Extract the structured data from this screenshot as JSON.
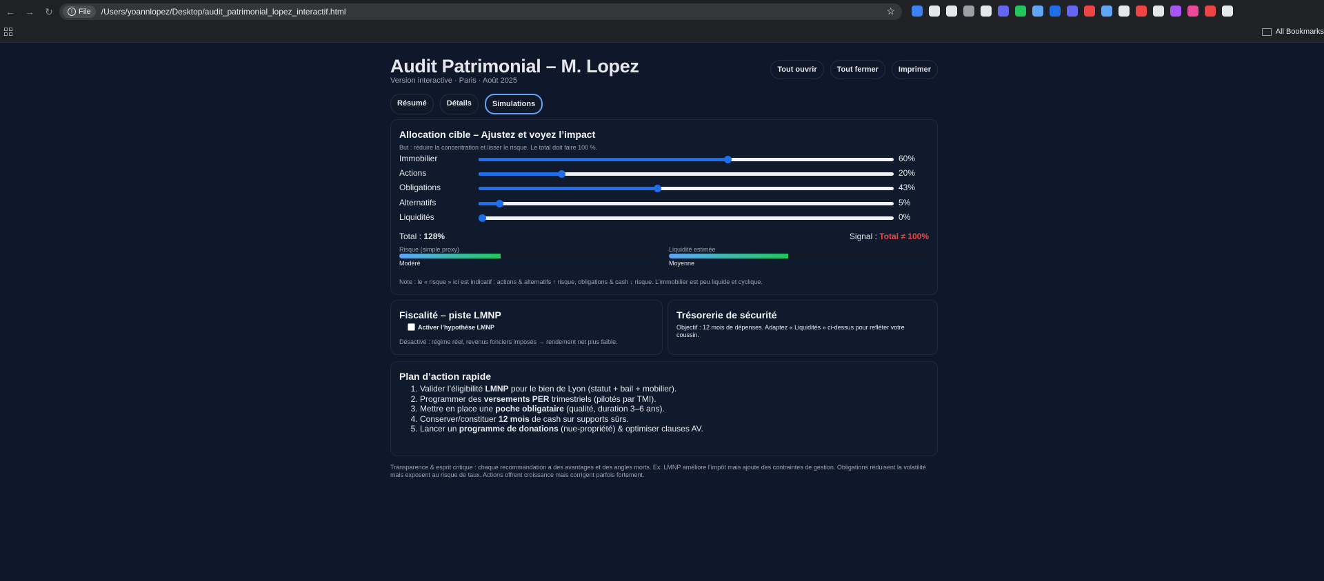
{
  "browser": {
    "file_chip": "File",
    "url": "/Users/yoannlopez/Desktop/audit_patrimonial_lopez_interactif.html",
    "all_bookmarks": "All Bookmarks",
    "extension_colors": [
      "#3b82f6",
      "#e5e7eb",
      "#e5e7eb",
      "#9aa0a6",
      "#e5e7eb",
      "#6366f1",
      "#22c55e",
      "#60a5fa",
      "#1f6feb",
      "#6366f1",
      "#ef4444",
      "#60a5fa",
      "#e5e7eb",
      "#ef4444",
      "#e5e7eb",
      "#a855f7",
      "#ec4899",
      "#ef4444",
      "#e5e7eb"
    ]
  },
  "header": {
    "title": "Audit Patrimonial – M. Lopez",
    "subtitle": "Version interactive · Paris · Août 2025",
    "btn_open": "Tout ouvrir",
    "btn_close": "Tout fermer",
    "btn_print": "Imprimer"
  },
  "tabs": [
    {
      "label": "Résumé"
    },
    {
      "label": "Détails"
    },
    {
      "label": "Simulations"
    }
  ],
  "allocation": {
    "title": "Allocation cible – Ajustez et voyez l’impact",
    "goal": "But : réduire la concentration et lisser le risque. Le total doit faire 100 %.",
    "sliders": [
      {
        "label": "Immobilier",
        "value": 60,
        "display": "60%"
      },
      {
        "label": "Actions",
        "value": 20,
        "display": "20%"
      },
      {
        "label": "Obligations",
        "value": 43,
        "display": "43%"
      },
      {
        "label": "Alternatifs",
        "value": 5,
        "display": "5%"
      },
      {
        "label": "Liquidités",
        "value": 0,
        "display": "0%"
      }
    ],
    "total_label": "Total :",
    "total_value": "128%",
    "signal_label": "Signal :",
    "signal_value": "Total ≠ 100%",
    "risk": {
      "label": "Risque (simple proxy)",
      "level": 0.39,
      "value": "Modéré"
    },
    "liquidity": {
      "label": "Liquidité estimée",
      "level": 0.46,
      "value": "Moyenne"
    },
    "note": "Note : le « risque » ici est indicatif : actions & alternatifs ↑ risque, obligations & cash ↓ risque. L’immobilier est peu liquide et cyclique."
  },
  "lmnp": {
    "title": "Fiscalité – piste LMNP",
    "checkbox_label": "Activer l’hypothèse LMNP",
    "desc": "Désactivé : régime réel, revenus fonciers imposés → rendement net plus faible."
  },
  "treso": {
    "title": "Trésorerie de sécurité",
    "desc": "Objectif : 12 mois de dépenses. Adaptez « Liquidités » ci-dessus pour refléter votre coussin."
  },
  "plan": {
    "title": "Plan d’action rapide",
    "items": [
      {
        "pre": "Valider l’éligibilité ",
        "bold": "LMNP",
        "post": " pour le bien de Lyon (statut + bail + mobilier)."
      },
      {
        "pre": "Programmer des ",
        "bold": "versements PER",
        "post": " trimestriels (pilotés par TMI)."
      },
      {
        "pre": "Mettre en place une ",
        "bold": "poche obligataire",
        "post": " (qualité, duration 3–6 ans)."
      },
      {
        "pre": "Conserver/constituer ",
        "bold": "12 mois",
        "post": " de cash sur supports sûrs."
      },
      {
        "pre": "Lancer un ",
        "bold": "programme de donations",
        "post": " (nue-propriété) & optimiser clauses AV."
      }
    ]
  },
  "footer": "Transparence & esprit critique : chaque recommandation a des avantages et des angles morts. Ex. LMNP améliore l’impôt mais ajoute des contraintes de gestion. Obligations réduisent la volatilité mais exposent au risque de taux. Actions offrent croissance mais corrigent parfois fortement."
}
